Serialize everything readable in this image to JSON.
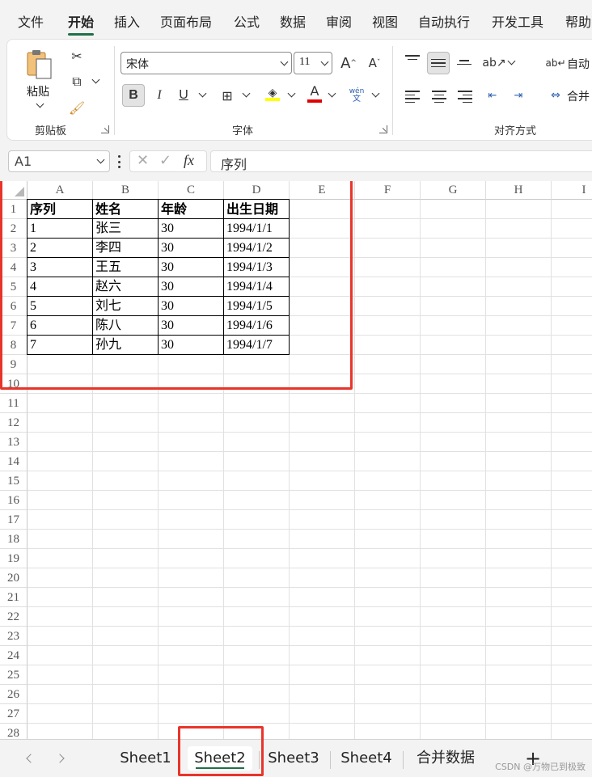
{
  "ribbon_tabs": [
    "文件",
    "开始",
    "插入",
    "页面布局",
    "公式",
    "数据",
    "审阅",
    "视图",
    "自动执行",
    "开发工具",
    "帮助"
  ],
  "active_ribbon_tab": "开始",
  "clipboard": {
    "paste_label": "粘贴",
    "group_label": "剪贴板"
  },
  "font": {
    "name": "宋体",
    "size": "11",
    "group_label": "字体",
    "bold": "B",
    "italic": "I",
    "underline": "U",
    "color_letter": "A",
    "phonetic_top": "wén",
    "phonetic_bottom": "文",
    "highlight_color": "#ffff00",
    "font_color": "#e00000"
  },
  "alignment": {
    "group_label": "对齐方式",
    "wrap_label": "自动",
    "merge_label": "合并"
  },
  "formula_bar": {
    "name_box": "A1",
    "content": "序列",
    "fx": "fx"
  },
  "columns": [
    "A",
    "B",
    "C",
    "D",
    "E",
    "F",
    "G",
    "H",
    "I"
  ],
  "rows": [
    "1",
    "2",
    "3",
    "4",
    "5",
    "6",
    "7",
    "8",
    "9",
    "10",
    "11",
    "12",
    "13",
    "14",
    "15",
    "16",
    "17",
    "18",
    "19",
    "20",
    "21",
    "22",
    "23",
    "24",
    "25",
    "26",
    "27",
    "28"
  ],
  "table": {
    "headers": [
      "序列",
      "姓名",
      "年龄",
      "出生日期"
    ],
    "records": [
      [
        "1",
        "张三",
        "30",
        "1994/1/1"
      ],
      [
        "2",
        "李四",
        "30",
        "1994/1/2"
      ],
      [
        "3",
        "王五",
        "30",
        "1994/1/3"
      ],
      [
        "4",
        "赵六",
        "30",
        "1994/1/4"
      ],
      [
        "5",
        "刘七",
        "30",
        "1994/1/5"
      ],
      [
        "6",
        "陈八",
        "30",
        "1994/1/6"
      ],
      [
        "7",
        "孙九",
        "30",
        "1994/1/7"
      ]
    ]
  },
  "sheet_tabs": [
    "Sheet1",
    "Sheet2",
    "Sheet3",
    "Sheet4",
    "合并数据"
  ],
  "active_sheet": "Sheet2",
  "add_sheet": "+",
  "watermark": "CSDN @万物已到极致",
  "accent_color": "#1e7145",
  "highlight_box_color": "#e8352b"
}
